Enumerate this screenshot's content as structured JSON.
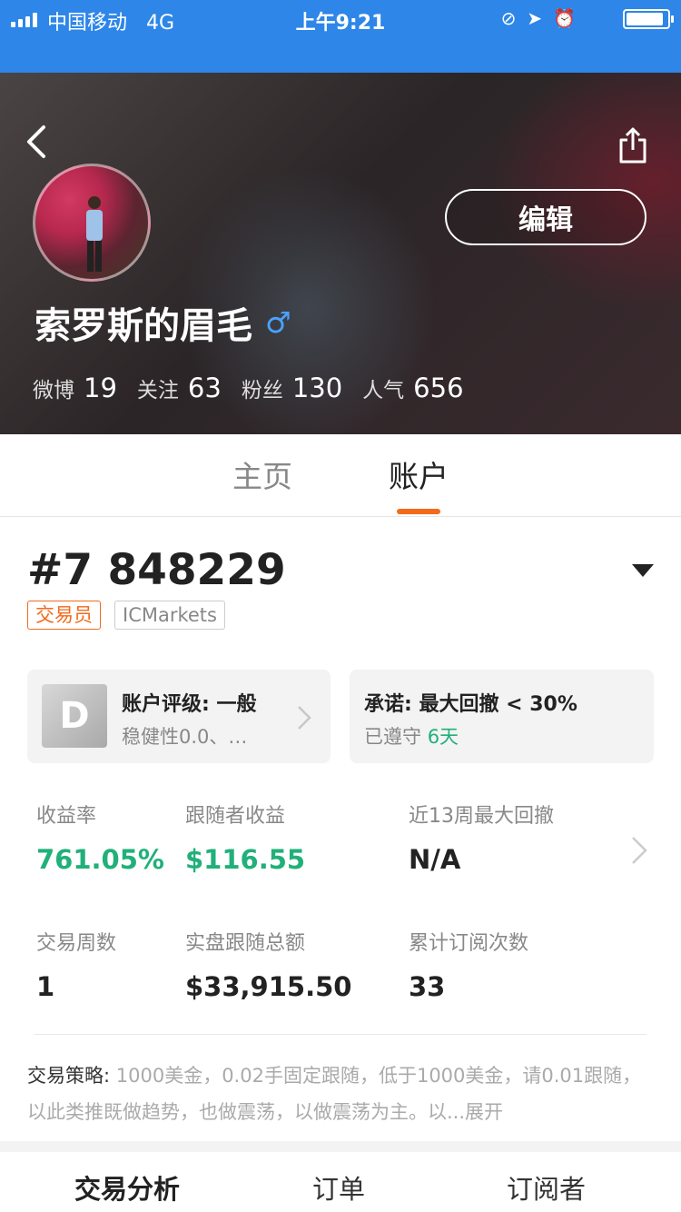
{
  "status_bar": {
    "carrier": "中国移动",
    "network": "4G",
    "time": "上午9:21"
  },
  "header": {
    "edit_label": "编辑",
    "username": "索罗斯的眉毛",
    "gender_symbol": "♂",
    "stats": [
      {
        "label": "微博",
        "value": "19"
      },
      {
        "label": "关注",
        "value": "63"
      },
      {
        "label": "粉丝",
        "value": "130"
      },
      {
        "label": "人气",
        "value": "656"
      }
    ]
  },
  "tabs": [
    {
      "label": "主页",
      "active": false
    },
    {
      "label": "账户",
      "active": true
    }
  ],
  "account": {
    "number": "#7 848229",
    "tags": [
      "交易员",
      "ICMarkets"
    ]
  },
  "cards": {
    "rating": {
      "badge": "D",
      "title": "账户评级: 一般",
      "subtitle": "稳健性0.0、…"
    },
    "promise": {
      "title": "承诺: 最大回撤 < 30%",
      "observed_label": "已遵守",
      "observed_days": "6天"
    }
  },
  "metrics": [
    {
      "label": "收益率",
      "value": "761.05%"
    },
    {
      "label": "跟随者收益",
      "value": "$116.55"
    },
    {
      "label": "近13周最大回撤",
      "value": "N/A"
    },
    {
      "label": "交易周数",
      "value": "1"
    },
    {
      "label": "实盘跟随总额",
      "value": "$33,915.50"
    },
    {
      "label": "累计订阅次数",
      "value": "33"
    }
  ],
  "strategy": {
    "label": "交易策略:",
    "text": " 1000美金，0.02手固定跟随，低于1000美金，请0.01跟随，以此类推既做趋势，也做震荡，以做震荡为主。以...",
    "expand": "展开"
  },
  "bottom_tabs": [
    {
      "label": "交易分析",
      "active": true
    },
    {
      "label": "订单",
      "active": false
    },
    {
      "label": "订阅者",
      "active": false
    }
  ],
  "colors": {
    "status_bar": "#2d86e8",
    "accent_orange": "#f26a1b",
    "positive_green": "#21b07a"
  }
}
